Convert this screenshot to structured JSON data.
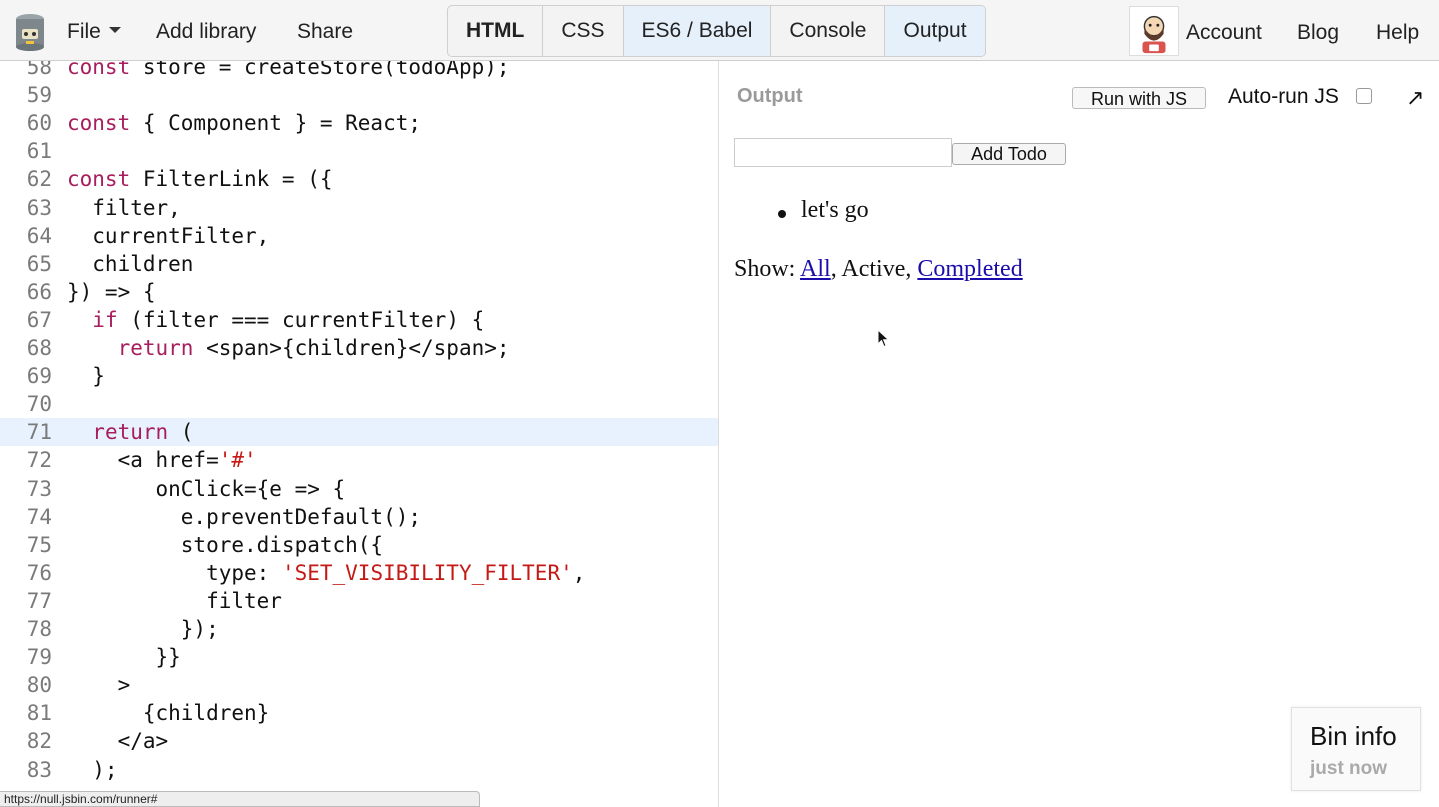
{
  "header": {
    "menu": {
      "file": "File",
      "add_library": "Add library",
      "share": "Share"
    },
    "panels": [
      "HTML",
      "CSS",
      "ES6 / Babel",
      "Console",
      "Output"
    ],
    "account": "Account",
    "blog": "Blog",
    "help": "Help"
  },
  "editor": {
    "lines": [
      {
        "num": "58",
        "text": "const store = createStore(todoApp);"
      },
      {
        "num": "59",
        "text": ""
      },
      {
        "num": "60",
        "text": "const { Component } = React;"
      },
      {
        "num": "61",
        "text": ""
      },
      {
        "num": "62",
        "text": "const FilterLink = ({"
      },
      {
        "num": "63",
        "text": "  filter,"
      },
      {
        "num": "64",
        "text": "  currentFilter,"
      },
      {
        "num": "65",
        "text": "  children"
      },
      {
        "num": "66",
        "text": "}) => {"
      },
      {
        "num": "67",
        "text": "  if (filter === currentFilter) {"
      },
      {
        "num": "68",
        "text": "    return <span>{children}</span>;"
      },
      {
        "num": "69",
        "text": "  }"
      },
      {
        "num": "70",
        "text": ""
      },
      {
        "num": "71",
        "text": "  return ("
      },
      {
        "num": "72",
        "text": "    <a href='#'"
      },
      {
        "num": "73",
        "text": "       onClick={e => {"
      },
      {
        "num": "74",
        "text": "         e.preventDefault();"
      },
      {
        "num": "75",
        "text": "         store.dispatch({"
      },
      {
        "num": "76",
        "text": "           type: 'SET_VISIBILITY_FILTER',"
      },
      {
        "num": "77",
        "text": "           filter"
      },
      {
        "num": "78",
        "text": "         });"
      },
      {
        "num": "79",
        "text": "       }}"
      },
      {
        "num": "80",
        "text": "    >"
      },
      {
        "num": "81",
        "text": "      {children}"
      },
      {
        "num": "82",
        "text": "    </a>"
      },
      {
        "num": "83",
        "text": "  );"
      }
    ],
    "highlighted_line": "71",
    "colors": {
      "keyword": "#a71d5d",
      "string": "#c41a16"
    }
  },
  "output": {
    "label": "Output",
    "run_button": "Run with JS",
    "autorun_label": "Auto-run JS",
    "autorun_checked": false,
    "add_todo_button": "Add Todo",
    "input_value": "",
    "todos": [
      "let's go"
    ],
    "filters": {
      "prefix": "Show: ",
      "all": "All",
      "sep1": ", ",
      "active": "Active",
      "sep2": ", ",
      "completed": "Completed"
    }
  },
  "bin_info": {
    "title": "Bin info",
    "subtitle": "just now"
  },
  "status_url": "https://null.jsbin.com/runner#"
}
